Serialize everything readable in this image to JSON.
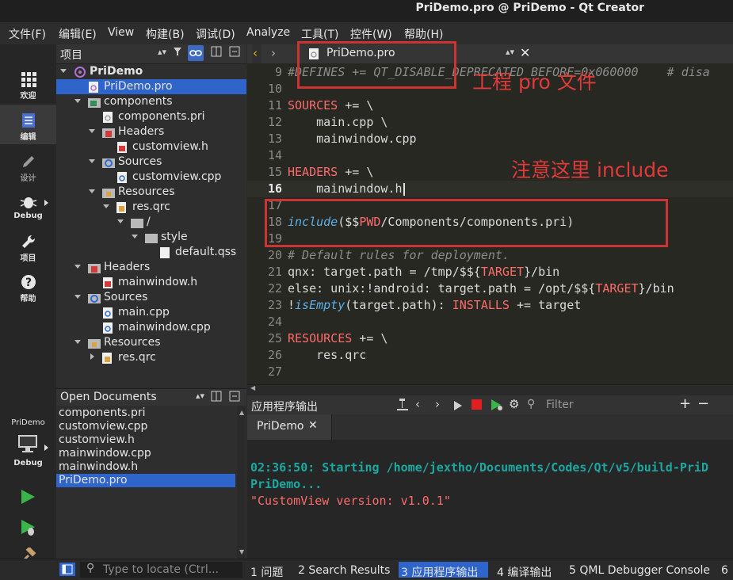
{
  "window": {
    "title": "PriDemo.pro @ PriDemo - Qt Creator"
  },
  "menu": [
    "文件(F)",
    "编辑(E)",
    "View",
    "构建(B)",
    "调试(D)",
    "Analyze",
    "工具(T)",
    "控件(W)",
    "帮助(H)"
  ],
  "modes": [
    {
      "label": "欢迎",
      "icon": "grid-icon"
    },
    {
      "label": "编辑",
      "icon": "document-icon"
    },
    {
      "label": "设计",
      "icon": "pencil-icon"
    },
    {
      "label": "Debug",
      "icon": "bug-icon"
    },
    {
      "label": "项目",
      "icon": "wrench-icon"
    },
    {
      "label": "帮助",
      "icon": "help-icon"
    }
  ],
  "kit": {
    "project": "PriDemo",
    "mode": "Debug"
  },
  "project_panel": {
    "title": "项目",
    "tree": [
      {
        "label": "PriDemo",
        "level": 0,
        "expanded": true,
        "kind": "project"
      },
      {
        "label": "PriDemo.pro",
        "level": 1,
        "kind": "file",
        "selected": true
      },
      {
        "label": "components",
        "level": 1,
        "expanded": true,
        "kind": "folder"
      },
      {
        "label": "components.pri",
        "level": 2,
        "kind": "file"
      },
      {
        "label": "Headers",
        "level": 2,
        "expanded": true,
        "kind": "headers"
      },
      {
        "label": "customview.h",
        "level": 3,
        "kind": "file"
      },
      {
        "label": "Sources",
        "level": 2,
        "expanded": true,
        "kind": "sources"
      },
      {
        "label": "customview.cpp",
        "level": 3,
        "kind": "file"
      },
      {
        "label": "Resources",
        "level": 2,
        "expanded": true,
        "kind": "resources"
      },
      {
        "label": "res.qrc",
        "level": 3,
        "expanded": true,
        "kind": "resources"
      },
      {
        "label": "/",
        "level": 4,
        "expanded": true,
        "kind": "folder"
      },
      {
        "label": "style",
        "level": 5,
        "expanded": true,
        "kind": "folder"
      },
      {
        "label": "default.qss",
        "level": 6,
        "kind": "file"
      },
      {
        "label": "Headers",
        "level": 1,
        "expanded": true,
        "kind": "headers"
      },
      {
        "label": "mainwindow.h",
        "level": 2,
        "kind": "file"
      },
      {
        "label": "Sources",
        "level": 1,
        "expanded": true,
        "kind": "sources"
      },
      {
        "label": "main.cpp",
        "level": 2,
        "kind": "file"
      },
      {
        "label": "mainwindow.cpp",
        "level": 2,
        "kind": "file"
      },
      {
        "label": "Resources",
        "level": 1,
        "expanded": true,
        "kind": "resources"
      },
      {
        "label": "res.qrc",
        "level": 2,
        "expanded": false,
        "kind": "resources"
      }
    ]
  },
  "open_documents": {
    "title": "Open Documents",
    "items": [
      "components.pri",
      "customview.cpp",
      "customview.h",
      "mainwindow.cpp",
      "mainwindow.h",
      "PriDemo.pro"
    ],
    "selected": "PriDemo.pro"
  },
  "editor": {
    "tab": "PriDemo.pro",
    "current_line": "16",
    "lines": [
      {
        "n": "9",
        "html": "<span class='cm'>#DEFINES += QT_DISABLE_DEPRECATED_BEFORE=0x060000    # disa</span>"
      },
      {
        "n": "10",
        "html": ""
      },
      {
        "n": "11",
        "html": "<span class='pp'>SOURCES</span> += \\"
      },
      {
        "n": "12",
        "html": "    main.cpp \\"
      },
      {
        "n": "13",
        "html": "    mainwindow.cpp"
      },
      {
        "n": "14",
        "html": ""
      },
      {
        "n": "15",
        "html": "<span class='pp'>HEADERS</span> += \\"
      },
      {
        "n": "16",
        "html": "    mainwindow.h"
      },
      {
        "n": "17",
        "html": ""
      },
      {
        "n": "18",
        "html": "<span class='fn'>include</span>($$<span class='pp'>PWD</span>/Components/components.pri)"
      },
      {
        "n": "19",
        "html": ""
      },
      {
        "n": "20",
        "html": "<span class='cm'># Default rules for deployment.</span>"
      },
      {
        "n": "21",
        "html": "qnx: target.path = /tmp/$${<span class='pp'>TARGET</span>}/bin"
      },
      {
        "n": "22",
        "html": "else: unix:!android: target.path = /opt/$${<span class='pp'>TARGET</span>}/bin"
      },
      {
        "n": "23",
        "html": "!<span class='fn'>isEmpty</span>(target.path): <span class='pp'>INSTALLS</span> += target"
      },
      {
        "n": "24",
        "html": ""
      },
      {
        "n": "25",
        "html": "<span class='pp'>RESOURCES</span> += \\"
      },
      {
        "n": "26",
        "html": "    res.qrc"
      },
      {
        "n": "27",
        "html": ""
      }
    ]
  },
  "annotations": {
    "pro_file": "工程 pro 文件",
    "include": "注意这里 include"
  },
  "output": {
    "title": "应用程序输出",
    "filter_placeholder": "Filter",
    "tab": "PriDemo",
    "lines": [
      {
        "text": "02:36:50: Starting /home/jextho/Documents/Codes/Qt/v5/build-PriD",
        "color": "#1aa8a0",
        "bold": true
      },
      {
        "text": "PriDemo...",
        "color": "#1aa8a0",
        "bold": true
      },
      {
        "text": "\"CustomView version: v1.0.1\"",
        "color": "#ff6b6b",
        "bold": false
      }
    ]
  },
  "statusbar": {
    "locate_placeholder": "Type to locate (Ctrl...",
    "panes": [
      "1 问题",
      "2 Search Results",
      "3 应用程序输出",
      "4 编译输出",
      "5 QML Debugger Console",
      "6"
    ],
    "active": "3 应用程序输出"
  },
  "colors": {
    "selection": "#2f65ca",
    "annotation": "#cc3333",
    "accent": "#1aa8a0"
  }
}
